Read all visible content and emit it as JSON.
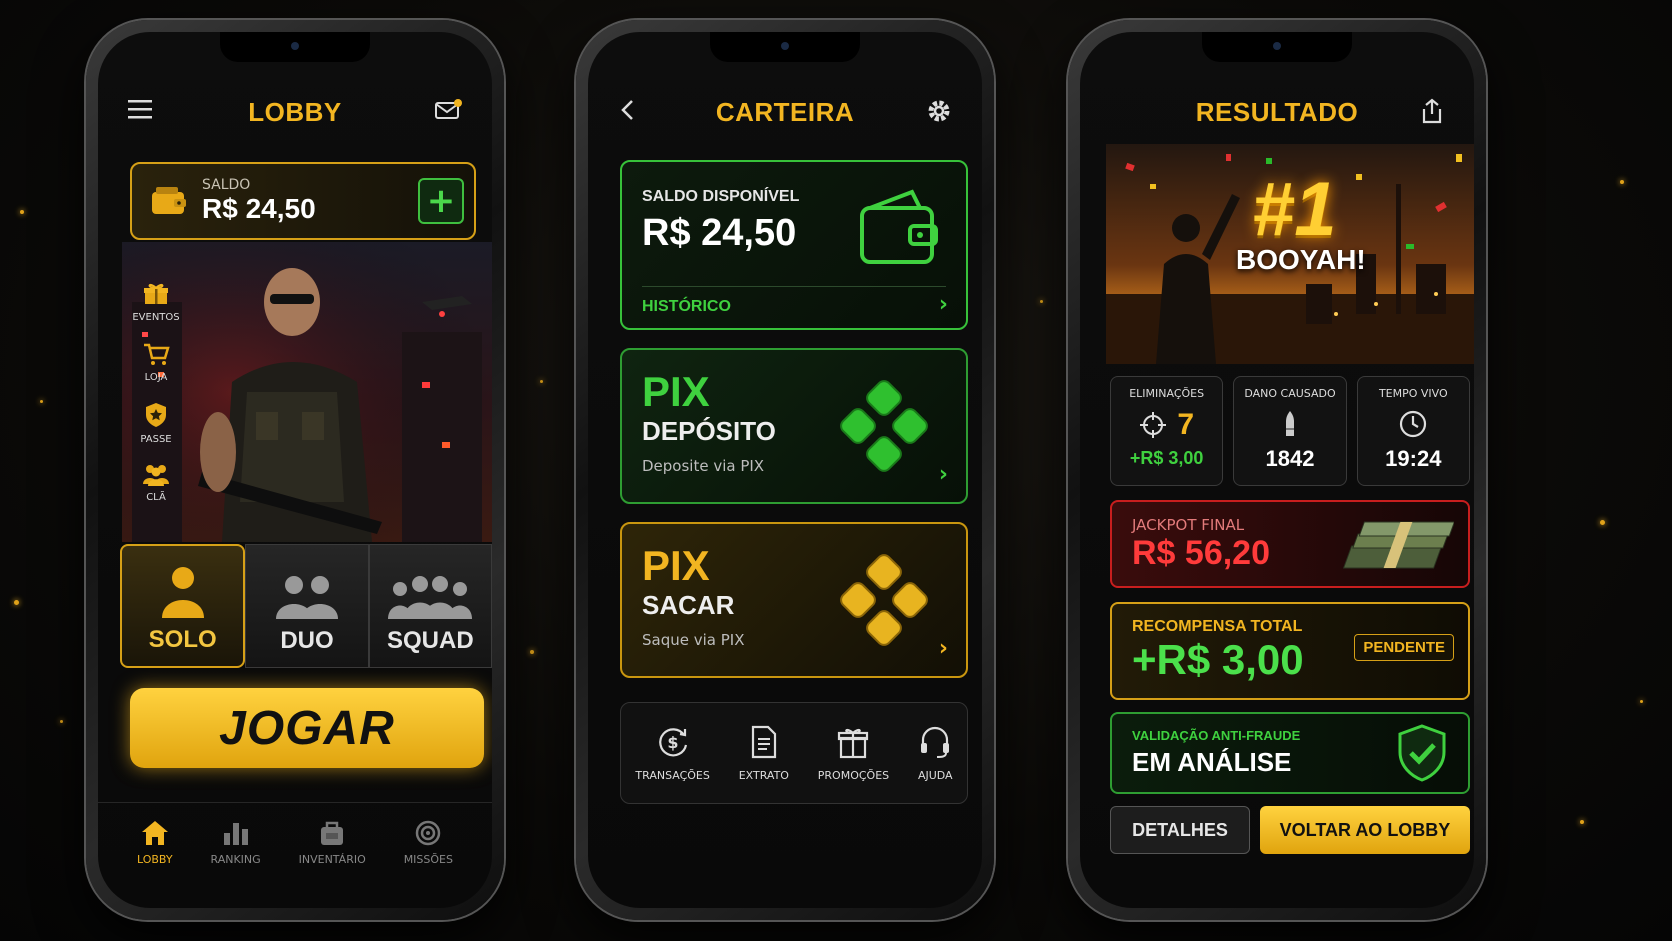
{
  "colors": {
    "gold": "#f2b521",
    "green": "#3fd13f",
    "red": "#ff3b3b",
    "bg": "#0b0a08"
  },
  "lobby": {
    "title": "LOBBY",
    "balance_label": "SALDO",
    "balance_value": "R$ 24,50",
    "side": [
      {
        "label": "EVENTOS",
        "icon": "gift-icon"
      },
      {
        "label": "LOJA",
        "icon": "cart-icon"
      },
      {
        "label": "PASSE",
        "icon": "star-shield-icon"
      },
      {
        "label": "CLÃ",
        "icon": "group-icon"
      }
    ],
    "modes": [
      {
        "label": "SOLO",
        "active": true
      },
      {
        "label": "DUO",
        "active": false
      },
      {
        "label": "SQUAD",
        "active": false
      }
    ],
    "play_label": "JOGAR",
    "nav": [
      {
        "label": "LOBBY",
        "icon": "home-icon",
        "active": true
      },
      {
        "label": "RANKING",
        "icon": "bar-chart-icon",
        "active": false
      },
      {
        "label": "INVENTÁRIO",
        "icon": "backpack-icon",
        "active": false
      },
      {
        "label": "MISSÕES",
        "icon": "target-icon",
        "active": false
      }
    ]
  },
  "wallet": {
    "title": "CARTEIRA",
    "available_label": "SALDO DISPONÍVEL",
    "available_value": "R$ 24,50",
    "history_label": "HISTÓRICO",
    "deposit": {
      "title": "PIX",
      "subtitle": "DEPÓSITO",
      "desc": "Deposite via PIX"
    },
    "withdraw": {
      "title": "PIX",
      "subtitle": "SACAR",
      "desc": "Saque via PIX"
    },
    "quick": [
      {
        "label": "TRANSAÇÕES",
        "icon": "dollar-refresh-icon"
      },
      {
        "label": "EXTRATO",
        "icon": "document-icon"
      },
      {
        "label": "PROMOÇÕES",
        "icon": "gift-icon"
      },
      {
        "label": "AJUDA",
        "icon": "headset-icon"
      }
    ]
  },
  "result": {
    "title": "RESULTADO",
    "rank": "#1",
    "booyah": "BOOYAH!",
    "stats": [
      {
        "label": "ELIMINAÇÕES",
        "value": "7",
        "extra": "+R$ 3,00",
        "icon": "crosshair-icon"
      },
      {
        "label": "DANO CAUSADO",
        "value": "1842",
        "icon": "bullet-icon"
      },
      {
        "label": "TEMPO VIVO",
        "value": "19:24",
        "icon": "clock-icon"
      }
    ],
    "jackpot_label": "JACKPOT FINAL",
    "jackpot_value": "R$ 56,20",
    "reward_label": "RECOMPENSA TOTAL",
    "reward_value": "+R$ 3,00",
    "reward_status": "PENDENTE",
    "fraud_label": "VALIDAÇÃO ANTI-FRAUDE",
    "fraud_value": "EM ANÁLISE",
    "details_label": "DETALHES",
    "back_label": "VOLTAR AO LOBBY"
  }
}
